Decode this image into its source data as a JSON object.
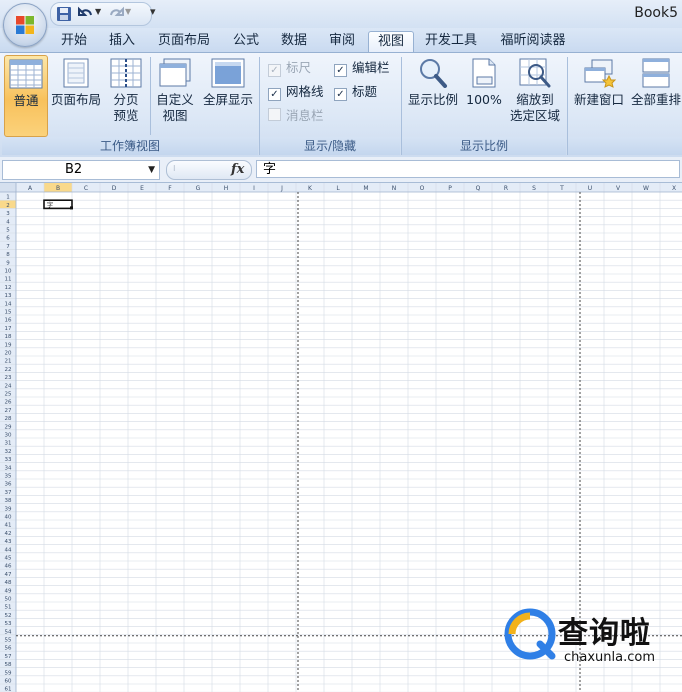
{
  "window": {
    "title": "Book5"
  },
  "tabs": [
    {
      "label": "开始"
    },
    {
      "label": "插入"
    },
    {
      "label": "页面布局"
    },
    {
      "label": "公式"
    },
    {
      "label": "数据"
    },
    {
      "label": "审阅"
    },
    {
      "label": "视图",
      "active": true
    },
    {
      "label": "开发工具"
    },
    {
      "label": "福昕阅读器"
    }
  ],
  "ribbon": {
    "workbook_views": {
      "group_label": "工作簿视图",
      "normal": "普通",
      "page_layout": "页面布局",
      "page_break_1": "分页",
      "page_break_2": "预览",
      "custom_views_1": "自定义",
      "custom_views_2": "视图",
      "full_screen": "全屏显示"
    },
    "show_hide": {
      "group_label": "显示/隐藏",
      "ruler": "标尺",
      "formula_bar": "编辑栏",
      "gridlines": "网格线",
      "headings": "标题",
      "message_bar": "消息栏"
    },
    "zoom": {
      "group_label": "显示比例",
      "zoom": "显示比例",
      "hundred": "100%",
      "zoom_sel_1": "缩放到",
      "zoom_sel_2": "选定区域"
    },
    "window": {
      "new_window": "新建窗口",
      "arrange_all": "全部重排"
    }
  },
  "formula_bar": {
    "name_box": "B2",
    "fx": "fx",
    "value": "字"
  },
  "grid": {
    "columns": [
      "A",
      "B",
      "C",
      "D",
      "E",
      "F",
      "G",
      "H",
      "I",
      "J",
      "K",
      "L",
      "M",
      "N",
      "O",
      "P",
      "Q",
      "R",
      "S",
      "T",
      "U",
      "V",
      "W",
      "X"
    ],
    "row_count": 61,
    "selected_cell": "B2",
    "selected_cell_value": "字",
    "colors": {
      "header_bg": "#e4ecf7",
      "gridline": "#d4dbe4",
      "selected_header": "#f9d98b"
    }
  },
  "watermark": {
    "main": "查询啦",
    "sub": "chaxunla.com"
  }
}
